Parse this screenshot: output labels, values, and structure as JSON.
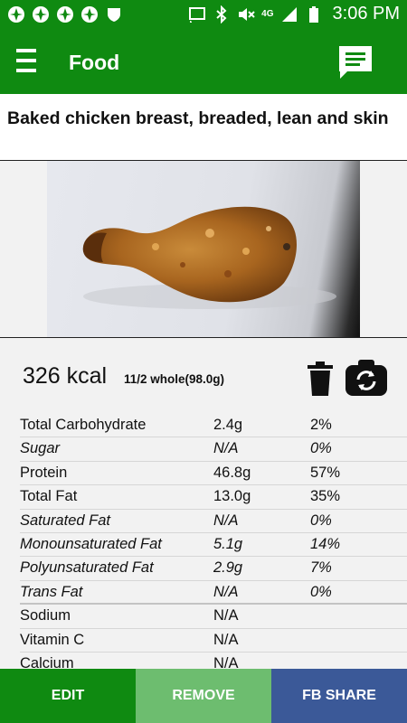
{
  "status_bar": {
    "time": "3:06 PM",
    "network": "4G",
    "icons": [
      "notification-icon",
      "notification-icon",
      "notification-icon",
      "notification-icon",
      "shield-icon",
      "cast-icon",
      "bluetooth-icon",
      "mute-icon",
      "signal-icon",
      "battery-icon"
    ]
  },
  "app_bar": {
    "title": "Food",
    "menu_icon": "hamburger-menu-icon",
    "action_icon": "chat-icon"
  },
  "food": {
    "name": "Baked chicken breast, breaded, lean and skin",
    "kcal": "326 kcal",
    "serving": "11/2 whole(98.0g)"
  },
  "nutrients": [
    {
      "name": "Total Carbohydrate",
      "amount": "2.4g",
      "pct": "2%",
      "italic": false
    },
    {
      "name": "Sugar",
      "amount": "N/A",
      "pct": "0%",
      "italic": true
    },
    {
      "name": "Protein",
      "amount": "46.8g",
      "pct": "57%",
      "italic": false
    },
    {
      "name": "Total Fat",
      "amount": "13.0g",
      "pct": "35%",
      "italic": false
    },
    {
      "name": "Saturated Fat",
      "amount": "N/A",
      "pct": "0%",
      "italic": true
    },
    {
      "name": "Monounsaturated Fat",
      "amount": "5.1g",
      "pct": "14%",
      "italic": true
    },
    {
      "name": "Polyunsaturated Fat",
      "amount": "2.9g",
      "pct": "7%",
      "italic": true
    },
    {
      "name": "Trans Fat",
      "amount": "N/A",
      "pct": "0%",
      "italic": true
    },
    {
      "name": "Sodium",
      "amount": "N/A",
      "pct": "",
      "italic": false
    },
    {
      "name": "Vitamin C",
      "amount": "N/A",
      "pct": "",
      "italic": false
    },
    {
      "name": "Calcium",
      "amount": "N/A",
      "pct": "",
      "italic": false
    }
  ],
  "actions": {
    "edit": "EDIT",
    "remove": "REMOVE",
    "share": "FB SHARE"
  },
  "colors": {
    "primary": "#0f8a11",
    "remove": "#6dbd6f",
    "share": "#3b5998"
  }
}
